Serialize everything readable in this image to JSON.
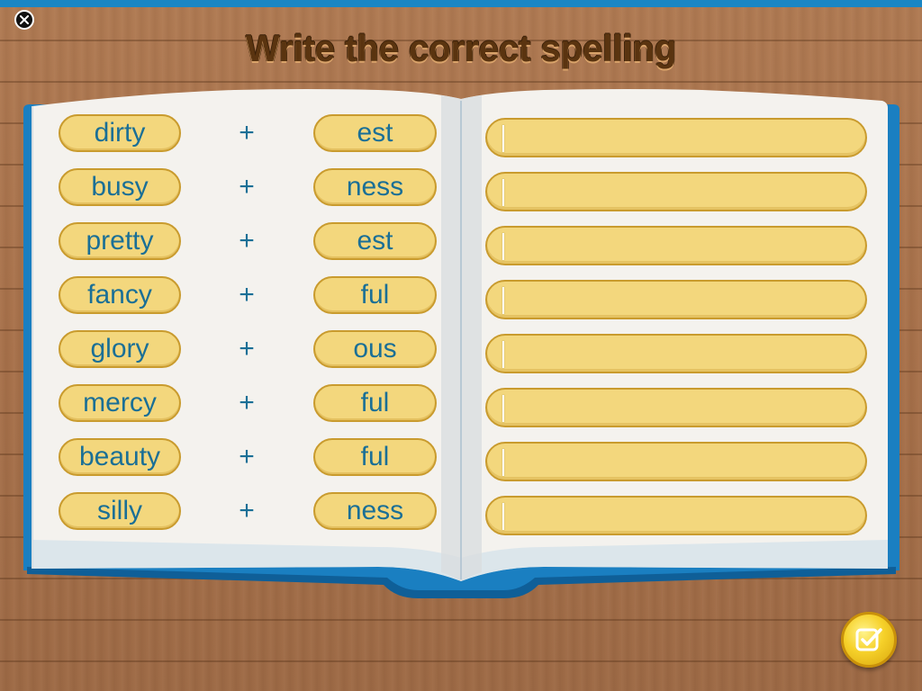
{
  "title": "Write the correct spelling",
  "colors": {
    "top_bar": "#1a86c4",
    "title_text": "#5a3410",
    "pill_fill": "#f3d77d",
    "pill_border": "#c99b2e",
    "word_text": "#1a6f96",
    "book_cover": "#1a7fc1",
    "check_button": "#f6d12a"
  },
  "icons": {
    "close": "close-icon",
    "check": "checkbox-check-icon"
  },
  "operator": "+",
  "rows": [
    {
      "word": "dirty",
      "suffix": "est",
      "answer": ""
    },
    {
      "word": "busy",
      "suffix": "ness",
      "answer": ""
    },
    {
      "word": "pretty",
      "suffix": "est",
      "answer": ""
    },
    {
      "word": "fancy",
      "suffix": "ful",
      "answer": ""
    },
    {
      "word": "glory",
      "suffix": "ous",
      "answer": ""
    },
    {
      "word": "mercy",
      "suffix": "ful",
      "answer": ""
    },
    {
      "word": "beauty",
      "suffix": "ful",
      "answer": ""
    },
    {
      "word": "silly",
      "suffix": "ness",
      "answer": ""
    }
  ]
}
